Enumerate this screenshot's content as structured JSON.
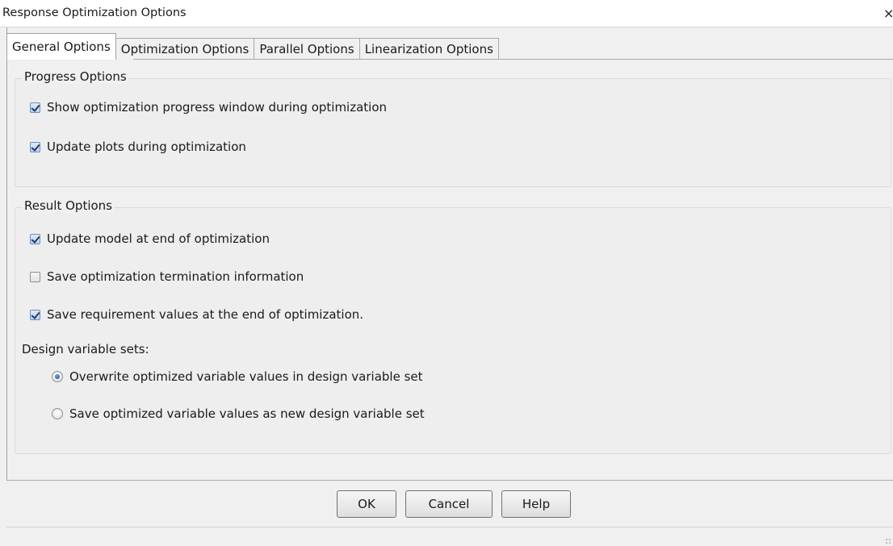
{
  "window": {
    "title": "Response Optimization Options",
    "close_glyph": "×"
  },
  "tabs": [
    {
      "label": "General Options",
      "active": true
    },
    {
      "label": "Optimization Options",
      "active": false
    },
    {
      "label": "Parallel Options",
      "active": false
    },
    {
      "label": "Linearization Options",
      "active": false
    }
  ],
  "progress_options": {
    "title": "Progress Options",
    "items": [
      {
        "label": "Show optimization progress window during optimization",
        "checked": true
      },
      {
        "label": "Update plots during optimization",
        "checked": true
      }
    ]
  },
  "result_options": {
    "title": "Result Options",
    "items": [
      {
        "label": "Update model at end of optimization",
        "checked": true
      },
      {
        "label": "Save optimization termination information",
        "checked": false
      },
      {
        "label": "Save requirement values at the end of optimization.",
        "checked": true
      }
    ],
    "design_sets_label": "Design variable sets:",
    "radios": [
      {
        "label": "Overwrite optimized variable values in design variable set",
        "selected": true
      },
      {
        "label": "Save optimized variable values as new design variable set",
        "selected": false
      }
    ]
  },
  "buttons": {
    "ok": "OK",
    "cancel": "Cancel",
    "help": "Help"
  }
}
